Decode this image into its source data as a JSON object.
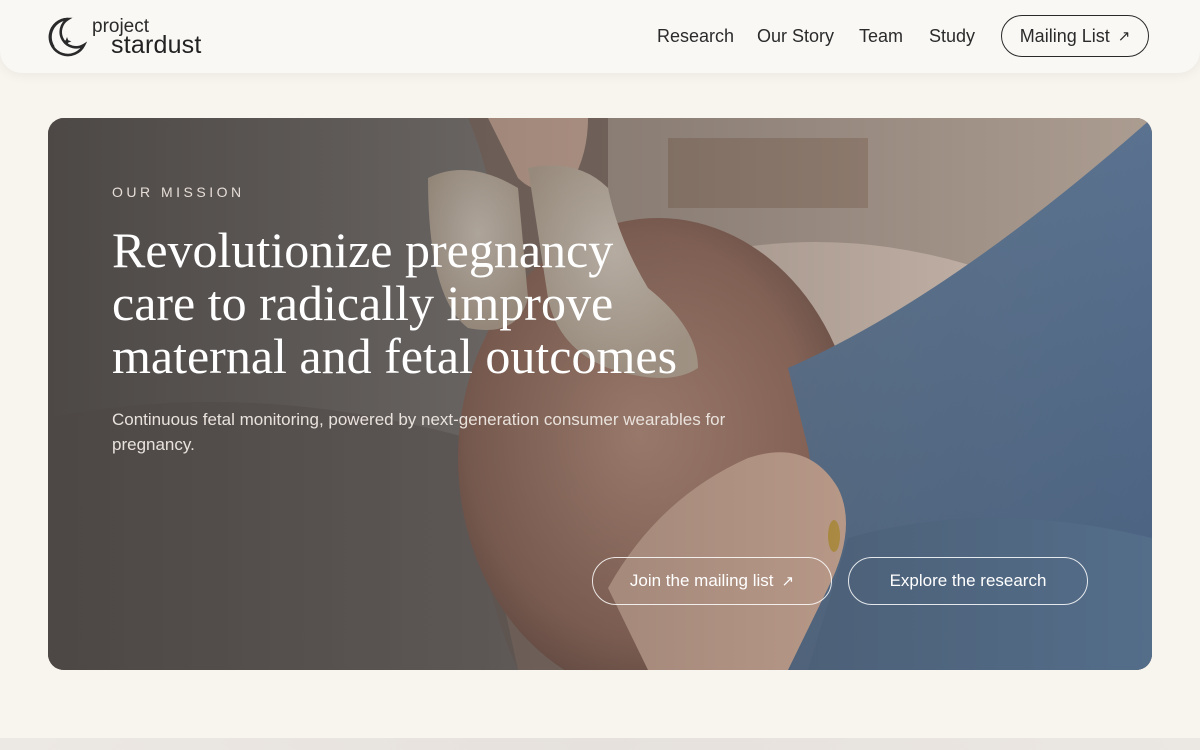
{
  "header": {
    "logo": {
      "prefix": "project",
      "name": "stardust",
      "icon": "crescent-star-logo-icon"
    },
    "nav": [
      {
        "label": "Research"
      },
      {
        "label": "Our Story"
      },
      {
        "label": "Team"
      },
      {
        "label": "Study"
      }
    ],
    "cta": {
      "label": "Mailing List",
      "icon": "external-arrow-icon",
      "glyph": "↗"
    }
  },
  "hero": {
    "eyebrow": "OUR MISSION",
    "headline_lines": [
      "Revolutionize pregnancy",
      "care to radically improve",
      "maternal and fetal outcomes"
    ],
    "subtext": "Continuous fetal monitoring, powered by next-generation consumer wearables for pregnancy.",
    "image": "photo-pregnant-belly-with-knit-baby-booties",
    "buttons": {
      "join": {
        "label": "Join the mailing list",
        "glyph": "↗"
      },
      "explore": {
        "label": "Explore the research"
      }
    }
  },
  "colors": {
    "page_bg": "#f8f4ee",
    "header_bg": "#f9f8f5",
    "text_dark": "#2b2b2b",
    "hero_text": "#ffffff"
  }
}
